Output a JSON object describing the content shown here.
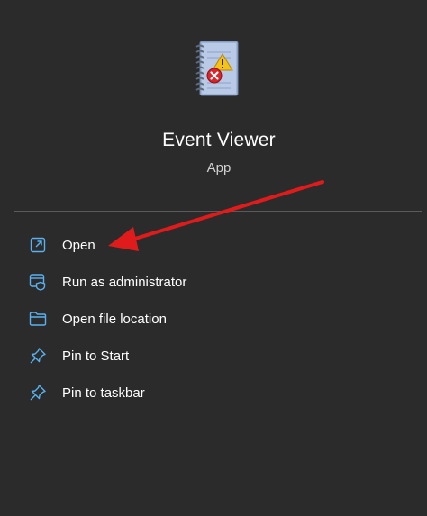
{
  "app": {
    "title": "Event Viewer",
    "type": "App",
    "icon": "event-viewer-icon"
  },
  "menu": {
    "items": [
      {
        "label": "Open",
        "icon": "open-external-icon"
      },
      {
        "label": "Run as administrator",
        "icon": "run-as-admin-icon"
      },
      {
        "label": "Open file location",
        "icon": "folder-icon"
      },
      {
        "label": "Pin to Start",
        "icon": "pin-icon"
      },
      {
        "label": "Pin to taskbar",
        "icon": "pin-icon"
      }
    ]
  },
  "colors": {
    "background": "#2b2b2b",
    "accent": "#5ab1ef",
    "annotation_arrow": "#e01b1b"
  }
}
